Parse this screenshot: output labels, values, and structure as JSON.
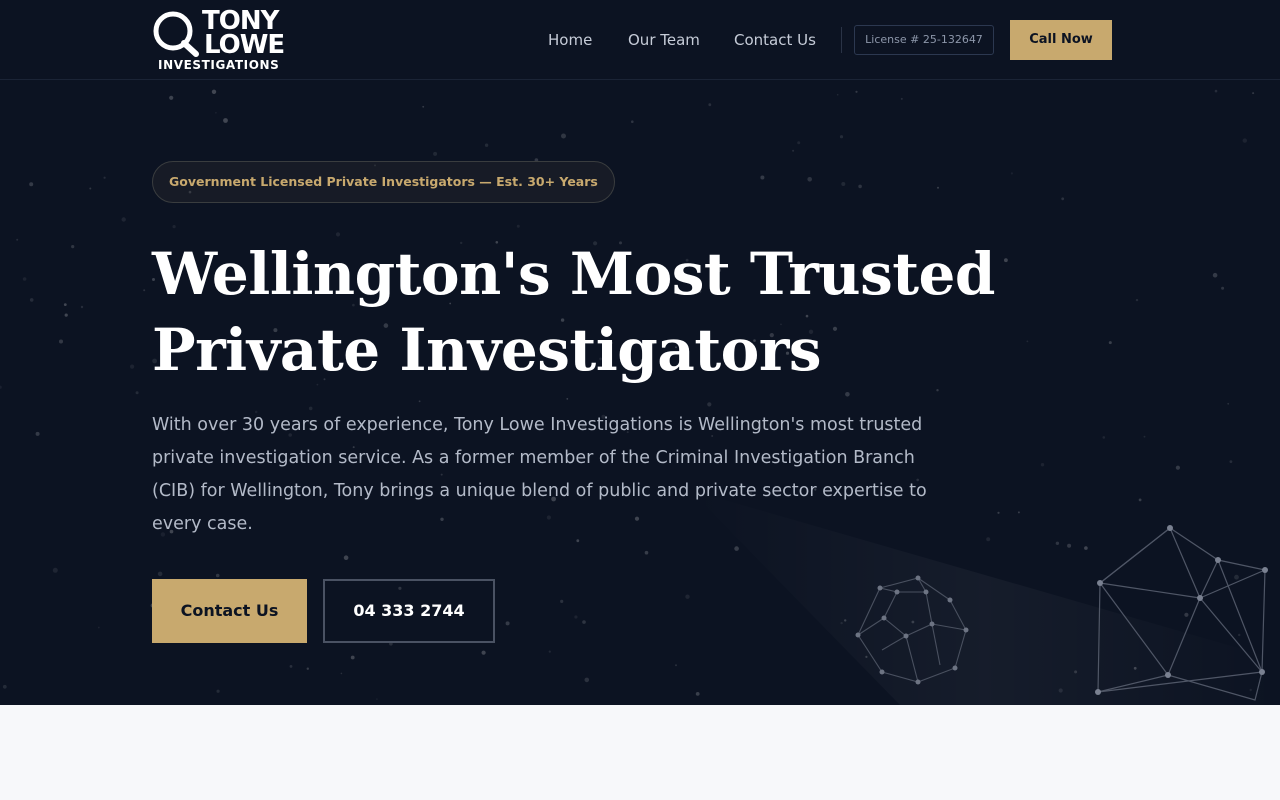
{
  "brand": {
    "line1": "TONY",
    "line2": "LOWE",
    "line3": "INVESTIGATIONS"
  },
  "nav": {
    "links": [
      "Home",
      "Our Team",
      "Contact Us"
    ],
    "license": "License # 25-132647",
    "cta": "Call Now"
  },
  "hero": {
    "badge": "Government Licensed Private Investigators — Est. 30+ Years",
    "title_line1": "Wellington's Most Trusted",
    "title_line2": "Private Investigators",
    "description": "With over 30 years of experience, Tony Lowe Investigations is Wellington's most trusted private investigation service. As a former member of the Criminal Investigation Branch (CIB) for Wellington, Tony brings a unique blend of public and private sector expertise to every case.",
    "primary_button": "Contact Us",
    "secondary_button": "04 333 2744"
  },
  "colors": {
    "background": "#0c1322",
    "accent": "#c8a96e",
    "text": "#ffffff",
    "muted_text": "#b3bac8",
    "section_below": "#f7f8fa"
  },
  "icons": {
    "logo_mark": "magnifying-glass-icon"
  }
}
